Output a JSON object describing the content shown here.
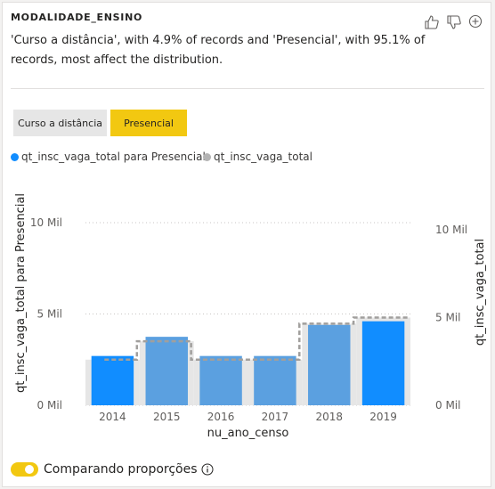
{
  "card": {
    "title": "MODALIDADE_ENSINO",
    "summary": "'Curso a distância', with 4.9% of records and 'Presencial', with 95.1% of records, most affect the distribution."
  },
  "icons": [
    "thumbs-up-icon",
    "thumbs-down-icon",
    "add-icon",
    "info-icon"
  ],
  "segments": [
    {
      "label": "Curso a distância",
      "selected": false
    },
    {
      "label": "Presencial",
      "selected": true
    }
  ],
  "legend": [
    {
      "label": "qt_insc_vaga_total para Presencial",
      "color": "#118dff"
    },
    {
      "label": "qt_insc_vaga_total",
      "color": "#b3b3b3"
    }
  ],
  "footer": {
    "toggle_label": "Comparando proporções",
    "toggle_on": true
  },
  "colors": {
    "accent": "#f2c811",
    "primary_bar": "#118dff",
    "overall_bar": "#e6e6e6"
  },
  "chart_data": {
    "type": "bar",
    "xlabel": "nu_ano_censo",
    "ylabel_left": "qt_insc_vaga_total para Presencial",
    "ylabel_right": "qt_insc_vaga_total",
    "categories": [
      "2014",
      "2015",
      "2016",
      "2017",
      "2018",
      "2019"
    ],
    "y_ticks": [
      "0 Mil",
      "5 Mil",
      "10 Mil"
    ],
    "ylim": [
      0,
      10000
    ],
    "series": [
      {
        "name": "qt_insc_vaga_total para Presencial",
        "values": [
          2700,
          3750,
          2700,
          2700,
          4400,
          4600
        ]
      },
      {
        "name": "qt_insc_vaga_total",
        "values": [
          2600,
          3650,
          2600,
          2600,
          4650,
          5000
        ]
      }
    ],
    "legend_position": "top-left",
    "grid": true
  }
}
